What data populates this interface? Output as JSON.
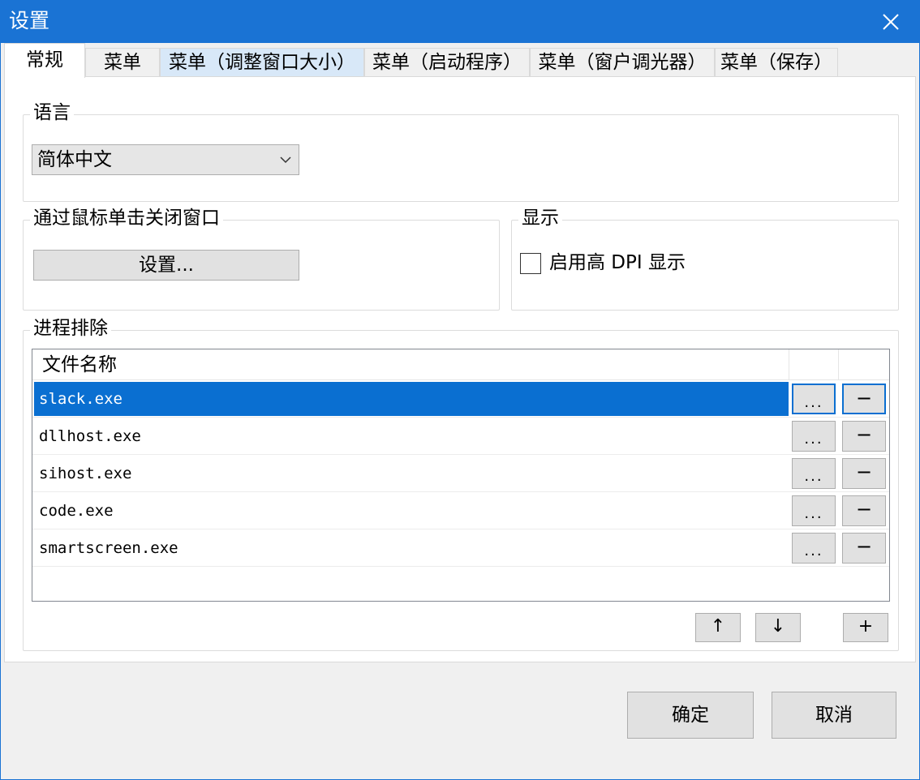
{
  "window": {
    "title": "设置",
    "close_icon": "close-icon"
  },
  "tabs": [
    {
      "label": "常规"
    },
    {
      "label": "菜单"
    },
    {
      "label": "菜单（调整窗口大小）"
    },
    {
      "label": "菜单（启动程序）"
    },
    {
      "label": "菜单（窗户调光器）"
    },
    {
      "label": "菜单（保存）"
    }
  ],
  "language": {
    "group_title": "语言",
    "selected": "简体中文"
  },
  "close_by_click": {
    "group_title": "通过鼠标单击关闭窗口",
    "button_label": "设置..."
  },
  "display": {
    "group_title": "显示",
    "checkbox_label": "启用高 DPI 显示",
    "checked": false
  },
  "process_exclusion": {
    "group_title": "进程排除",
    "column_header": "文件名称",
    "rows": [
      {
        "name": "slack.exe",
        "browse": "...",
        "remove": "−"
      },
      {
        "name": "dllhost.exe",
        "browse": "...",
        "remove": "−"
      },
      {
        "name": "sihost.exe",
        "browse": "...",
        "remove": "−"
      },
      {
        "name": "code.exe",
        "browse": "...",
        "remove": "−"
      },
      {
        "name": "smartscreen.exe",
        "browse": "...",
        "remove": "−"
      }
    ],
    "up_label": "↑",
    "down_label": "↓",
    "add_label": "+"
  },
  "footer": {
    "ok_label": "确定",
    "cancel_label": "取消"
  },
  "colors": {
    "accent": "#1a73d4",
    "selection": "#0a6fd1"
  }
}
